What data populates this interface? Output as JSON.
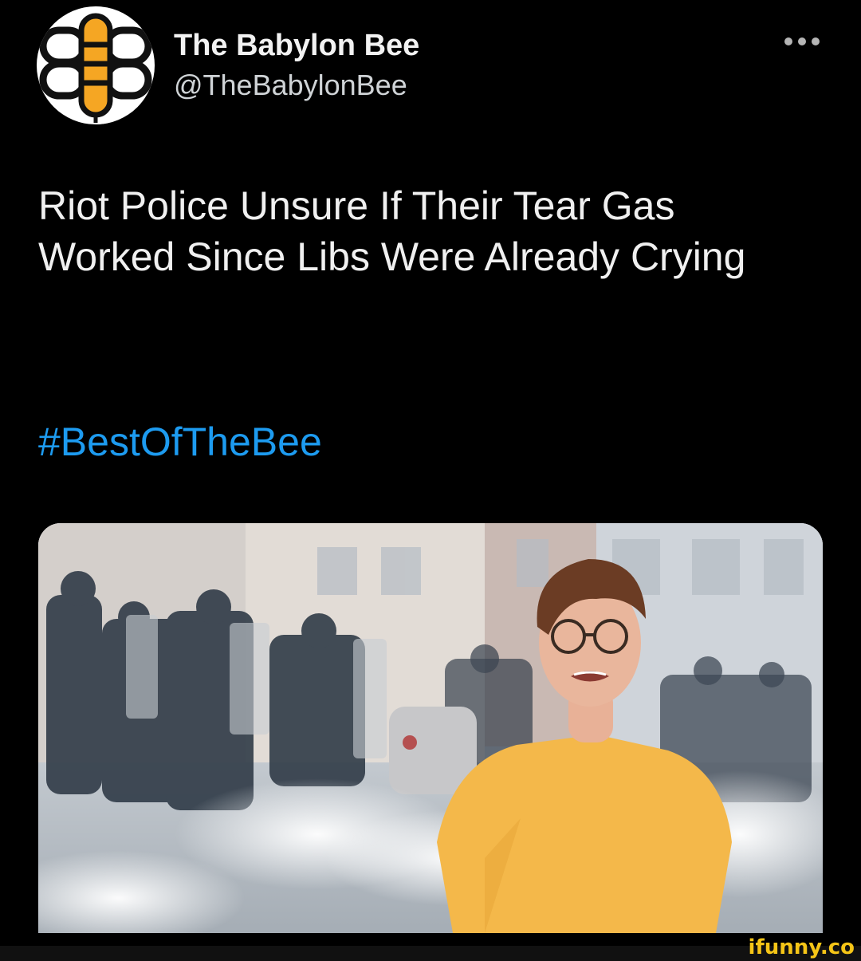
{
  "tweet": {
    "display_name": "The Babylon Bee",
    "handle": "@TheBabylonBee",
    "text": "Riot Police Unsure If Their Tear Gas Worked Since Libs Were Already Crying",
    "hashtag": "#BestOfTheBee",
    "more_icon": "ellipsis-icon",
    "avatar_icon": "bee-logo-icon",
    "media_description_icon": "photo-icon"
  },
  "watermark": {
    "text": "ifunny.co",
    "color": "#f5c517"
  },
  "colors": {
    "background": "#000000",
    "link": "#1d9bf0",
    "text": "#f0f0f0"
  }
}
